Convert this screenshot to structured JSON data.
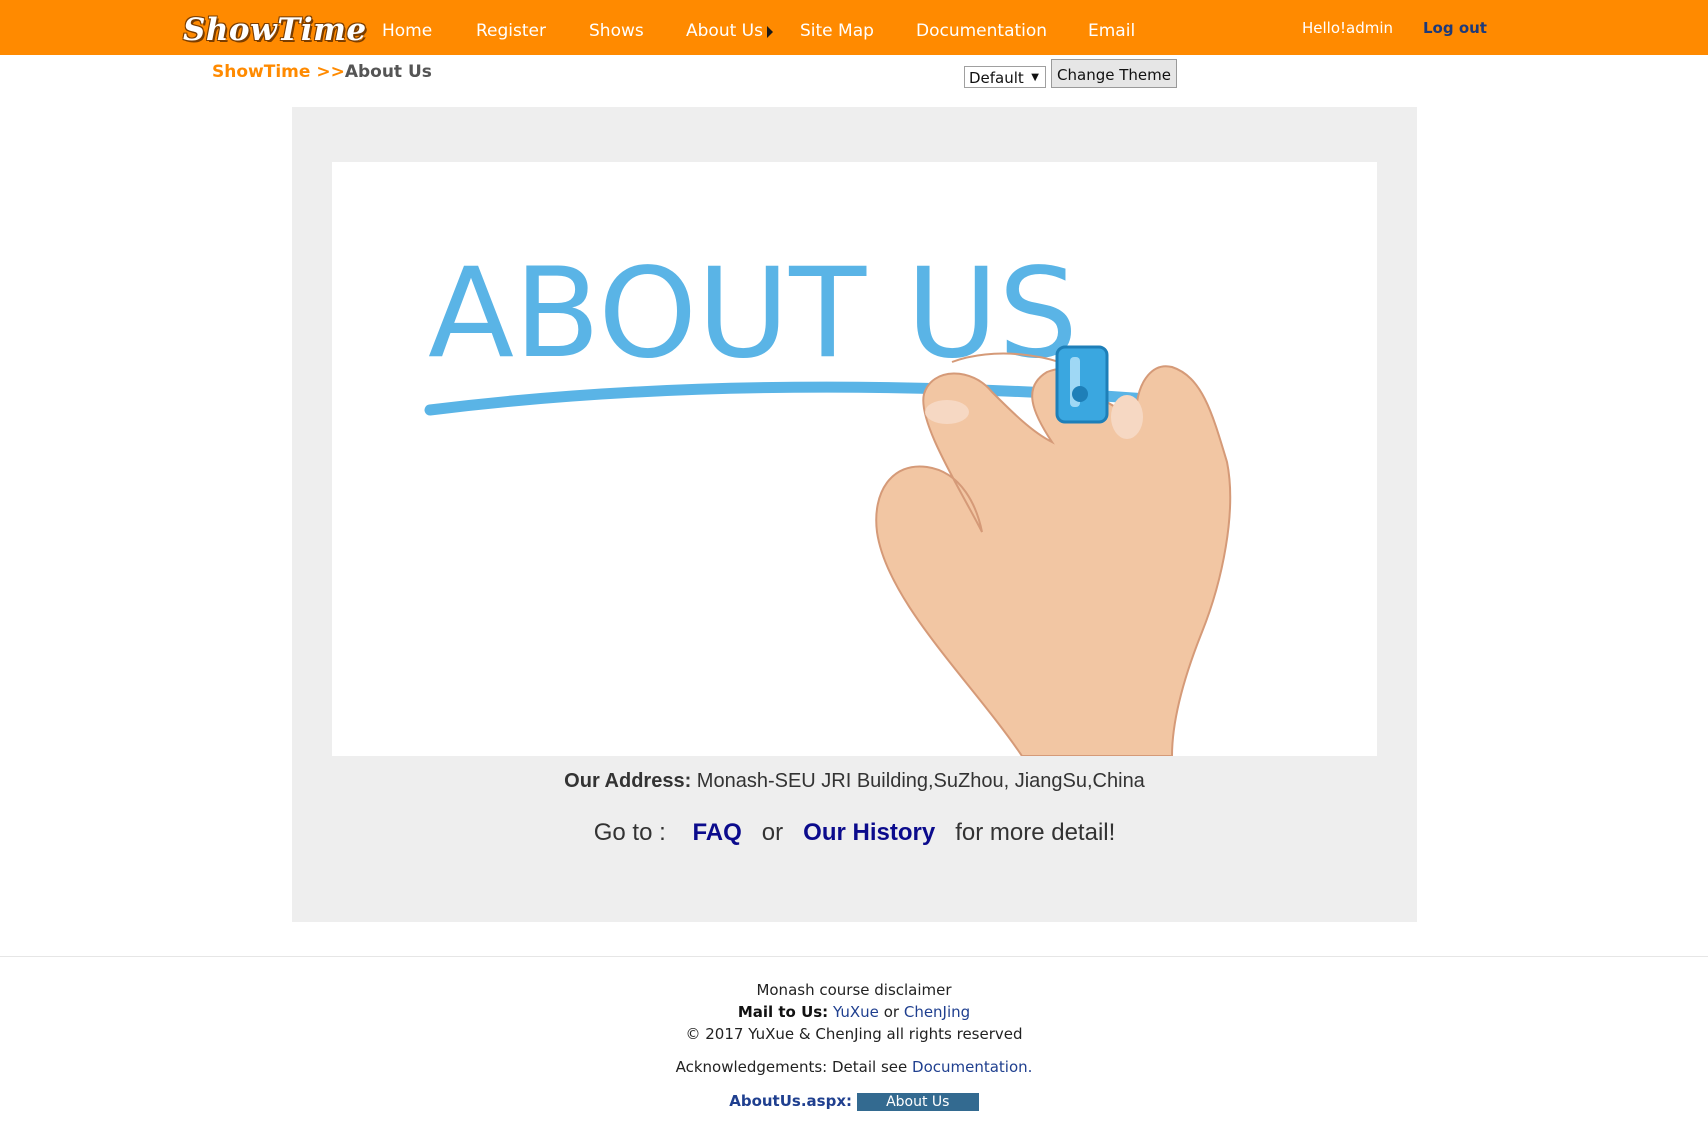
{
  "header": {
    "logo": "ShowTime",
    "nav": [
      {
        "label": "Home"
      },
      {
        "label": "Register"
      },
      {
        "label": "Shows"
      },
      {
        "label": "About Us"
      },
      {
        "label": "Site Map"
      },
      {
        "label": "Documentation"
      },
      {
        "label": "Email"
      }
    ],
    "greeting": "Hello!admin",
    "logout": "Log out",
    "colors": {
      "bar": "#ff8a00",
      "logout": "#1d3a7a"
    }
  },
  "breadcrumb": {
    "root": "ShowTime",
    "separator": " >>",
    "current": "About Us"
  },
  "theme": {
    "selected": "Default",
    "button": "Change Theme"
  },
  "main": {
    "hero_text": "ABOUT US",
    "address_label": "Our Address:",
    "address_value": " Monash-SEU JRI Building,SuZhou, JiangSu,China",
    "goto_prefix": "Go to :",
    "faq": "FAQ",
    "or": "or",
    "history": "Our History",
    "suffix": "for more detail!"
  },
  "footer": {
    "disclaimer": "Monash course disclaimer",
    "mail_label": "Mail to Us:",
    "mail_1": "YuXue",
    "mail_or": "or",
    "mail_2": "ChenJing",
    "copyright": "© 2017 YuXue & ChenJing all rights reserved",
    "ack_prefix": "Acknowledgements: Detail see",
    "ack_link": "Documentation.",
    "file_label": "AboutUs.aspx:",
    "file_badge": "About Us"
  }
}
